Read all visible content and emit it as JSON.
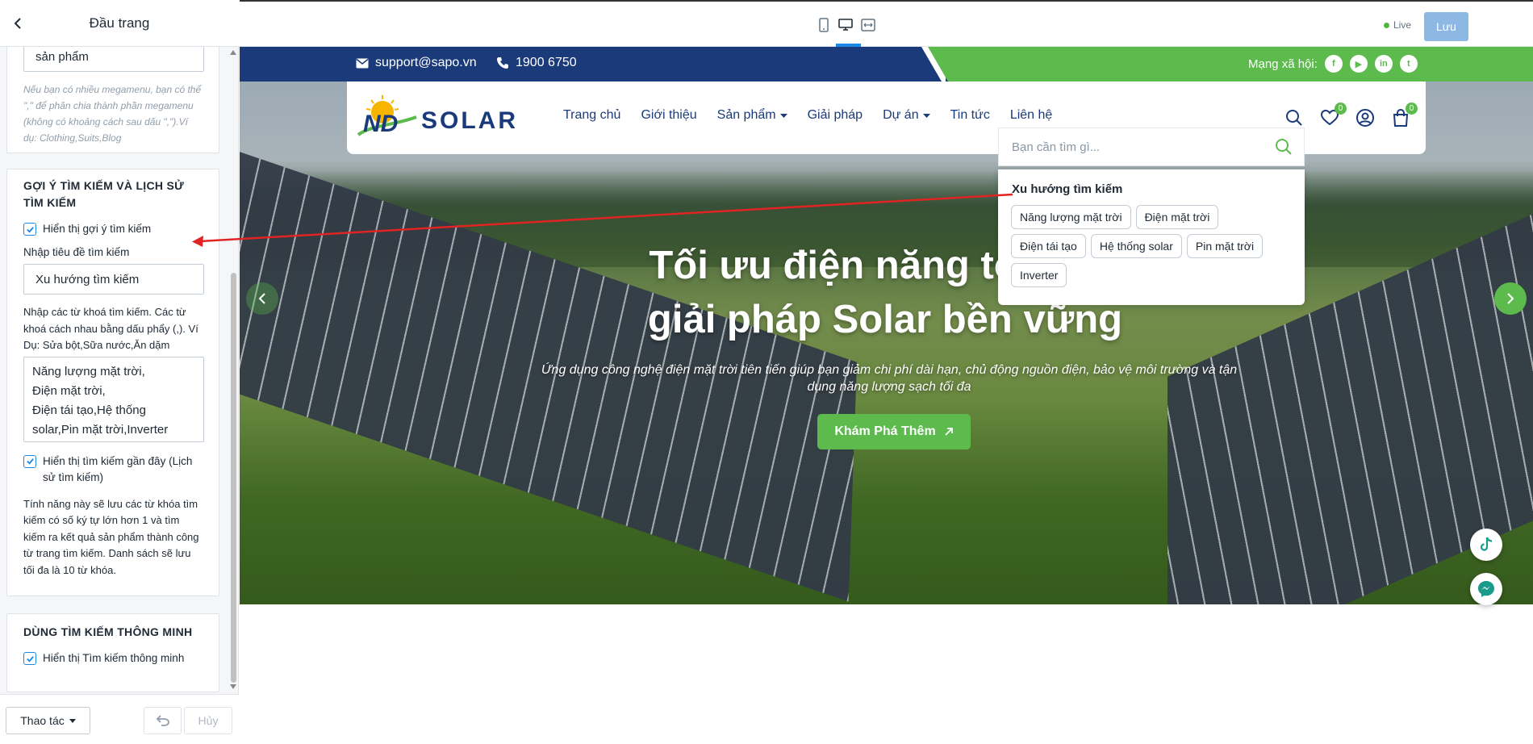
{
  "panel": {
    "title": "Đầu trang",
    "prev_card": {
      "input_value": "sản phẩm",
      "hint": "Nếu bạn có nhiều megamenu, bạn có thể \",\" để phân chia thành phần megamenu (không có khoảng cách sau dấu \",\").Ví dụ: Clothing,Suits,Blog"
    },
    "search_card": {
      "title": "GỢI Ý TÌM KIẾM VÀ LỊCH SỬ TÌM KIẾM",
      "show_suggest_label": "Hiển thị gợi ý tìm kiếm",
      "heading_label": "Nhập tiêu đề tìm kiếm",
      "heading_value": "Xu hướng tìm kiếm",
      "keywords_label": "Nhập các từ khoá tìm kiếm. Các từ khoá cách nhau bằng dấu phẩy (,). Ví Dụ: Sửa bột,Sữa nước,Ăn dặm",
      "keywords_value": "Năng lượng mặt trời,\nĐiện mặt trời,\nĐiện tái tạo,Hệ thống solar,Pin mặt trời,Inverter",
      "show_recent_label": "Hiển thị tìm kiếm gần đây (Lịch sử tìm kiếm)",
      "recent_desc": "Tính năng này sẽ lưu các từ khóa tìm kiếm có số ký tự lớn hơn 1 và tìm kiếm ra kết quả sản phẩm thành công từ trang tìm kiếm. Danh sách sẽ lưu tối đa là 10 từ khóa."
    },
    "smart_card": {
      "title": "DÙNG TÌM KIẾM THÔNG MINH",
      "show_smart_label": "Hiển thị Tìm kiếm thông minh"
    },
    "footer": {
      "actions_label": "Thao tác",
      "cancel_label": "Hủy"
    }
  },
  "toolbar": {
    "live_label": "Live",
    "save_label": "Lưu"
  },
  "site": {
    "email": "support@sapo.vn",
    "phone": "1900 6750",
    "social_label": "Mạng xã hội:",
    "social_icons": [
      "facebook-icon",
      "youtube-icon",
      "linkedin-icon",
      "tumblr-icon"
    ],
    "logo_text": "SOLAR",
    "logo_mark": "ND",
    "nav": [
      "Trang chủ",
      "Giới thiệu",
      "Sản phẩm",
      "Giải pháp",
      "Dự án",
      "Tin tức",
      "Liên hệ"
    ],
    "wishlist_count": "0",
    "cart_count": "0",
    "search": {
      "placeholder": "Bạn cần tìm gì...",
      "trending_title": "Xu hướng tìm kiếm",
      "chips": [
        "Năng lượng mặt trời",
        "Điện mặt trời",
        "Điện tái tạo",
        "Hệ thống solar",
        "Pin mặt trời",
        "Inverter"
      ]
    },
    "hero": {
      "title": "Tối ưu điện năng tối đa h",
      "title_line2": "giải pháp Solar bền vững",
      "subtitle": "Ứng dụng công nghệ điện mặt trời tiên tiến giúp bạn giảm chi phí dài hạn, chủ động nguồn điện, bảo vệ môi trường và tận dụng năng lượng sạch tối đa",
      "cta": "Khám Phá Thêm"
    }
  },
  "colors": {
    "brand_navy": "#1a3a7a",
    "brand_green": "#5dbb4e",
    "accent_blue": "#1e88e5",
    "annotation_red": "#e02424"
  }
}
